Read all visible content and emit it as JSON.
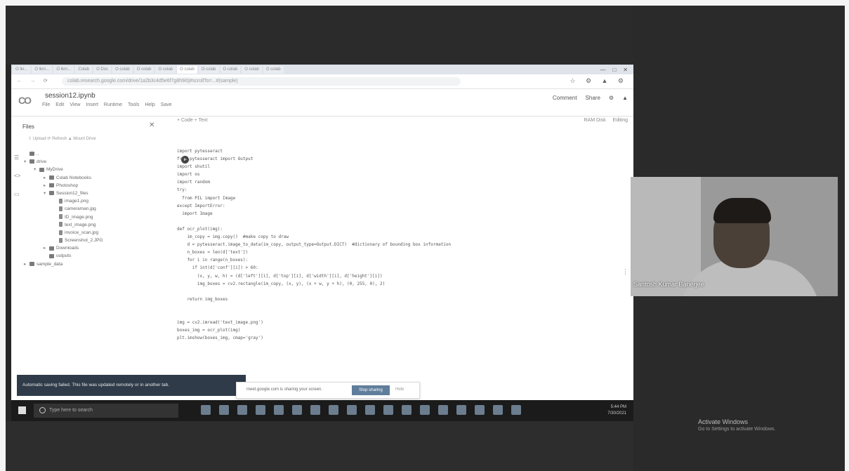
{
  "browser": {
    "tabs": [
      "O lkr...",
      "O lkrn...",
      "O lkrn...",
      "Colab",
      "O Doc",
      "O colab",
      "O colab",
      "O colab",
      "O colab",
      "O colab",
      "O colab",
      "O colab",
      "O colab"
    ],
    "url": "colab.research.google.com/drive/1a2b3c4d5e6f7g8h9i0j#scrollTo=...#(sample)",
    "window_controls": [
      "—",
      "□",
      "✕"
    ]
  },
  "colab": {
    "notebook_name": "session12.ipynb",
    "menu": [
      "File",
      "Edit",
      "View",
      "Insert",
      "Runtime",
      "Tools",
      "Help",
      "Save"
    ],
    "header_actions": [
      "Comment",
      "Share"
    ],
    "code_toolbar": "+ Code  + Text",
    "ram_label": "RAM\nDisk",
    "editing_label": "Editing"
  },
  "files_panel": {
    "title": "Files",
    "actions": "⇪ Upload   ⟳ Refresh   ▲ Mount Drive",
    "tree": [
      {
        "label": "..",
        "indent": 0,
        "kind": "folder",
        "arrow": ""
      },
      {
        "label": "drive",
        "indent": 0,
        "kind": "folder",
        "arrow": "▾"
      },
      {
        "label": "MyDrive",
        "indent": 1,
        "kind": "folder",
        "arrow": "▾"
      },
      {
        "label": "Colab Notebooks",
        "indent": 2,
        "kind": "folder",
        "arrow": "▸"
      },
      {
        "label": "Photoshop",
        "indent": 2,
        "kind": "folder",
        "arrow": "▸"
      },
      {
        "label": "Session12_files",
        "indent": 2,
        "kind": "folder",
        "arrow": "▾"
      },
      {
        "label": "image1.png",
        "indent": 3,
        "kind": "file",
        "arrow": ""
      },
      {
        "label": "cameraman.jpg",
        "indent": 3,
        "kind": "file",
        "arrow": ""
      },
      {
        "label": "ID_image.png",
        "indent": 3,
        "kind": "file",
        "arrow": ""
      },
      {
        "label": "text_image.png",
        "indent": 3,
        "kind": "file",
        "arrow": ""
      },
      {
        "label": "invoice_scan.jpg",
        "indent": 3,
        "kind": "file",
        "arrow": ""
      },
      {
        "label": "Screenshot_2.JPG",
        "indent": 3,
        "kind": "file",
        "arrow": ""
      },
      {
        "label": "Downloads",
        "indent": 2,
        "kind": "folder",
        "arrow": "▸"
      },
      {
        "label": "outputs",
        "indent": 2,
        "kind": "folder",
        "arrow": ""
      },
      {
        "label": "sample_data",
        "indent": 0,
        "kind": "folder",
        "arrow": "▸"
      }
    ]
  },
  "code_lines": [
    "import pytesseract",
    "from pytesseract import Output",
    "import shutil",
    "import os",
    "import random",
    "try:",
    "  from PIL import Image",
    "except ImportError:",
    "  import Image",
    "",
    "def ocr_plot(img):",
    "    im_copy = img.copy()  #make copy to draw",
    "    d = pytesseract.image_to_data(im_copy, output_type=Output.DICT)  #dictionary of bounding box information",
    "    n_boxes = len(d['text'])",
    "    for i in range(n_boxes):",
    "      if int(d['conf'][i]) > 60:",
    "        (x, y, w, h) = (d['left'][i], d['top'][i], d['width'][i], d['height'][i])",
    "        img_boxes = cv2.rectangle(im_copy, (x, y), (x + w, y + h), (0, 255, 0), 2)",
    "",
    "    return img_boxes",
    "",
    "",
    "img = cv2.imread('text_image.png')",
    "boxes_img = ocr_plot(img)",
    "plt.imshow(boxes_img, cmap='gray')"
  ],
  "toast_text": "Automatic saving failed. This file was updated remotely or in another tab.",
  "notice": {
    "text": "meet.google.com is sharing your screen.",
    "stop_button": "Stop sharing",
    "hide": "Hide"
  },
  "taskbar": {
    "search_placeholder": "Type here to search",
    "time": "5:44 PM",
    "date": "7/30/2021"
  },
  "webcam": {
    "participant_name": "Santosh Kumar Banerjee"
  },
  "activate_windows": {
    "title": "Activate Windows",
    "subtitle": "Go to Settings to activate Windows."
  }
}
